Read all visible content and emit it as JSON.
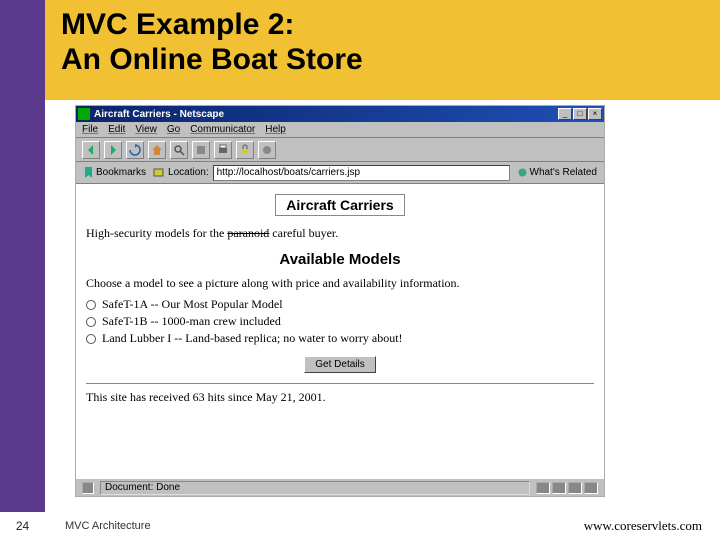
{
  "slide": {
    "title_line1": "MVC Example 2:",
    "title_line2": "An Online Boat Store",
    "number": "24",
    "footer_left": "MVC Architecture",
    "footer_right": "www.coreservlets.com"
  },
  "browser": {
    "window_title": "Aircraft Carriers - Netscape",
    "menus": [
      "File",
      "Edit",
      "View",
      "Go",
      "Communicator",
      "Help"
    ],
    "bookmarks_label": "Bookmarks",
    "location_label": "Location:",
    "location_value": "http://localhost/boats/carriers.jsp",
    "related_label": "What's Related",
    "status_text": "Document: Done"
  },
  "page": {
    "heading": "Aircraft Carriers",
    "intro_before": "High-security models for the ",
    "intro_strike": "paranoid",
    "intro_after": " careful buyer.",
    "subhead": "Available Models",
    "choose_text": "Choose a model to see a picture along with price and availability information.",
    "models": [
      "SafeT-1A -- Our Most Popular Model",
      "SafeT-1B -- 1000-man crew included",
      "Land Lubber I -- Land-based replica; no water to worry about!"
    ],
    "submit_label": "Get Details",
    "hits_text": "This site has received 63 hits since May 21, 2001."
  }
}
